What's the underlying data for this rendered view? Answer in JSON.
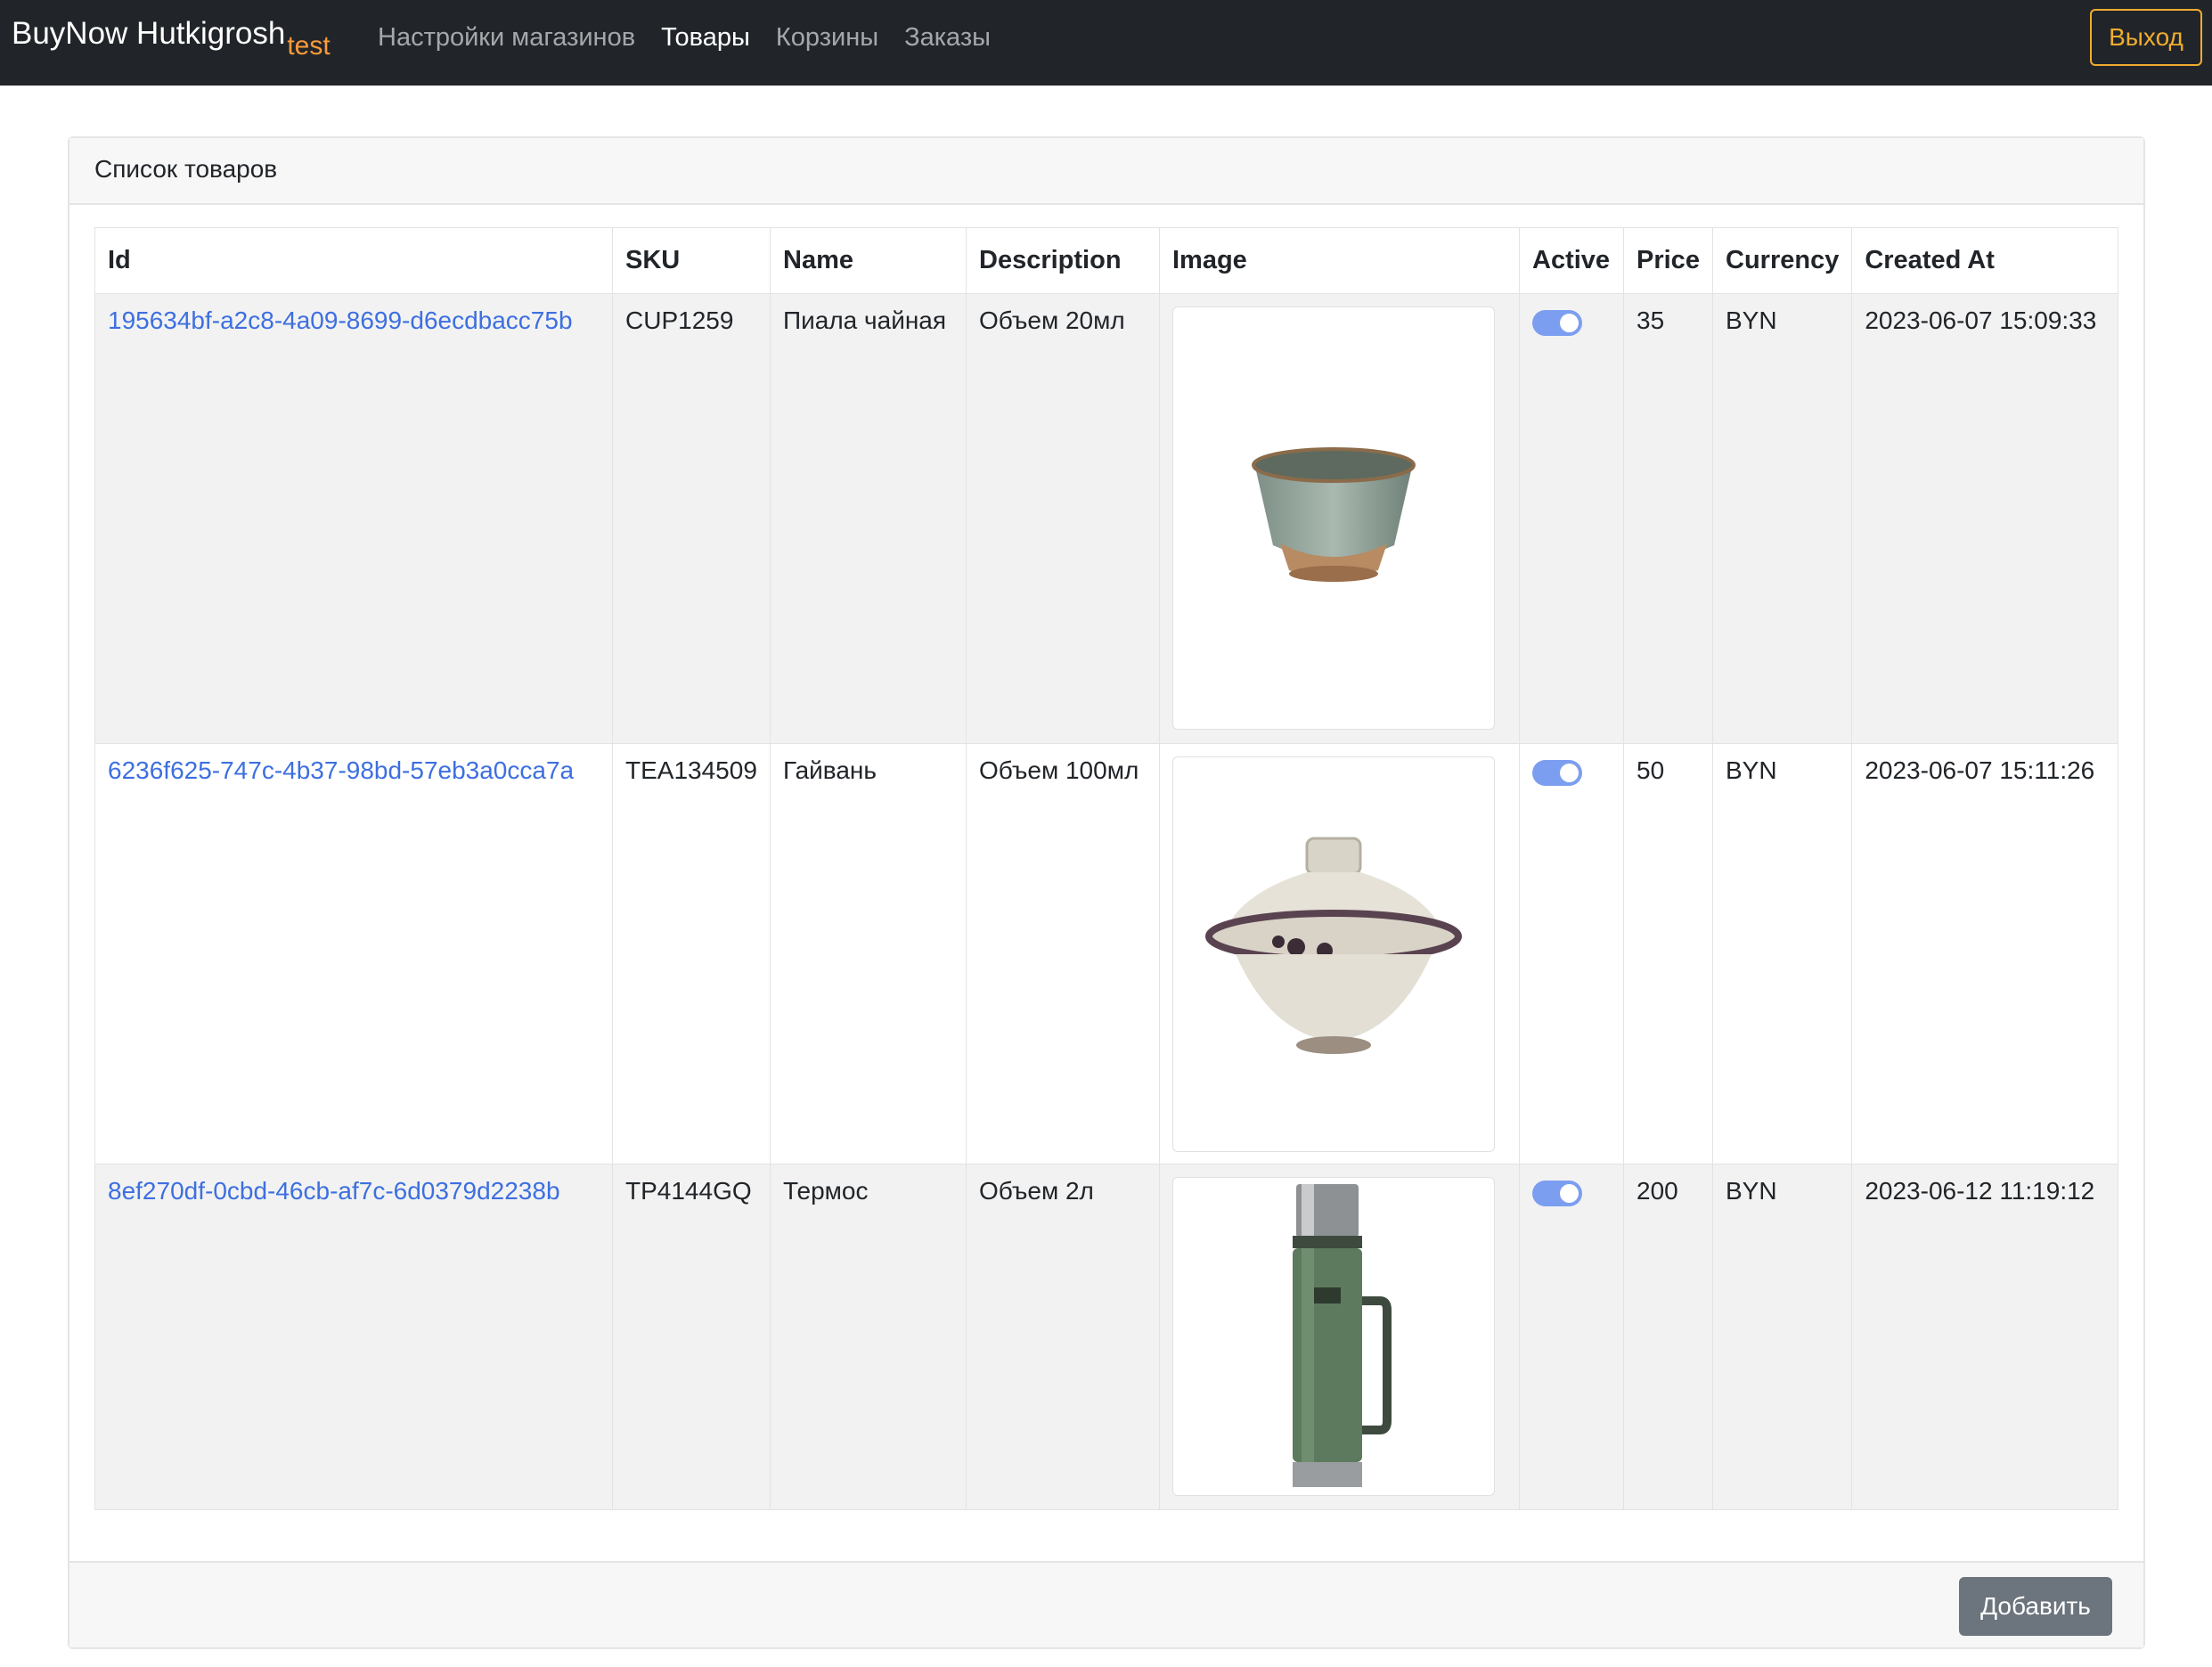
{
  "navbar": {
    "brand": "BuyNow Hutkigrosh",
    "brand_sub": "test",
    "links": [
      "Настройки магазинов",
      "Товары",
      "Корзины",
      "Заказы"
    ],
    "active_link": "Товары",
    "logout": "Выход"
  },
  "card": {
    "title": "Список товаров",
    "add_button": "Добавить"
  },
  "table": {
    "headers": [
      "Id",
      "SKU",
      "Name",
      "Description",
      "Image",
      "Active",
      "Price",
      "Currency",
      "Created At"
    ],
    "rows": [
      {
        "id": "195634bf-a2c8-4a09-8699-d6ecdbacc75b",
        "sku": "CUP1259",
        "name": "Пиала чайная",
        "description": "Объем 20мл",
        "image": "tea-cup-photo",
        "active": true,
        "price": "35",
        "currency": "BYN",
        "created_at": "2023-06-07 15:09:33"
      },
      {
        "id": "6236f625-747c-4b37-98bd-57eb3a0cca7a",
        "sku": "TEA134509",
        "name": "Гайвань",
        "description": "Объем 100мл",
        "image": "gaiwan-photo",
        "active": true,
        "price": "50",
        "currency": "BYN",
        "created_at": "2023-06-07 15:11:26"
      },
      {
        "id": "8ef270df-0cbd-46cb-af7c-6d0379d2238b",
        "sku": "TP4144GQ",
        "name": "Термос",
        "description": "Объем 2л",
        "image": "thermos-photo",
        "active": true,
        "price": "200",
        "currency": "BYN",
        "created_at": "2023-06-12 11:19:12"
      }
    ]
  },
  "colors": {
    "navbar_bg": "#212529",
    "link": "#3d6fe0",
    "logout_accent": "#f0ad2e",
    "brand_sub": "#fd9a3a",
    "toggle_on": "#7c9ef0",
    "add_button_bg": "#6c757d"
  }
}
